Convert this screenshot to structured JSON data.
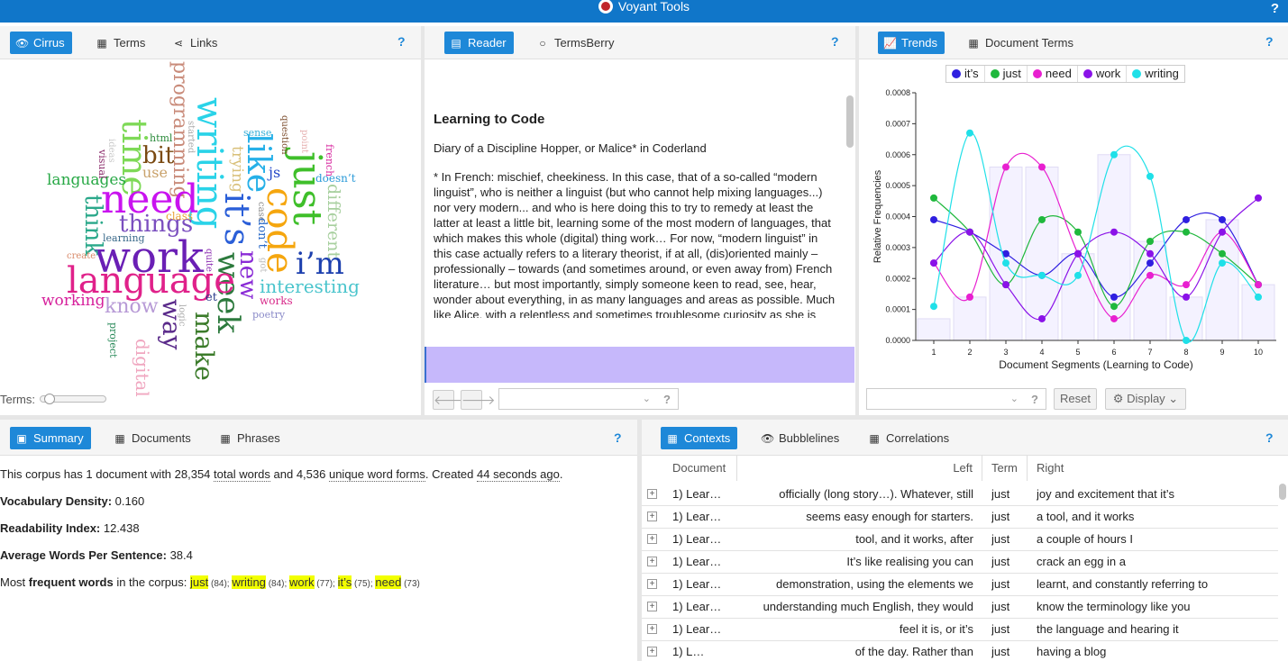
{
  "app": {
    "title": "Voyant Tools",
    "help": "?"
  },
  "panels": {
    "cirrus": {
      "tabs": [
        "Cirrus",
        "Terms",
        "Links"
      ],
      "help": "?",
      "terms_label": "Terms:",
      "cloud": [
        {
          "w": "programming",
          "c": "#c98b7a"
        },
        {
          "w": "writing",
          "c": "#2ad3e8"
        },
        {
          "w": "like",
          "c": "#26b0e8"
        },
        {
          "w": "just",
          "c": "#3fbf2a"
        },
        {
          "w": "code",
          "c": "#f5a60e"
        },
        {
          "w": "time",
          "c": "#7ed957"
        },
        {
          "w": "need",
          "c": "#c913ef"
        },
        {
          "w": "it’s",
          "c": "#2b5fd8"
        },
        {
          "w": "week",
          "c": "#2c7a3d"
        },
        {
          "w": "work",
          "c": "#6a1fb5"
        },
        {
          "w": "language",
          "c": "#e0218a"
        },
        {
          "w": "i’m",
          "c": "#1c3fae"
        },
        {
          "w": "things",
          "c": "#7b4fbf"
        },
        {
          "w": "bit",
          "c": "#7a4a12"
        },
        {
          "w": "languages",
          "c": "#27a845"
        },
        {
          "w": "think",
          "c": "#2aa88a"
        },
        {
          "w": "new",
          "c": "#8a2bd6"
        },
        {
          "w": "way",
          "c": "#5a2a8a"
        },
        {
          "w": "make",
          "c": "#3b7b2a"
        },
        {
          "w": "interesting",
          "c": "#49c4cc"
        },
        {
          "w": "different",
          "c": "#a7cf9e"
        },
        {
          "w": "know",
          "c": "#b79ad6"
        },
        {
          "w": "working",
          "c": "#d61f9b"
        },
        {
          "w": "digital",
          "c": "#f0a7c0"
        },
        {
          "w": "use",
          "c": "#c9a26b"
        },
        {
          "w": "js",
          "c": "#2648c8"
        },
        {
          "w": "trying",
          "c": "#d9c07a"
        },
        {
          "w": "html",
          "c": "#2a8a3a"
        },
        {
          "w": "class",
          "c": "#e8a43a"
        },
        {
          "w": "learning",
          "c": "#3a6a8a"
        },
        {
          "w": "doesn’t",
          "c": "#2a9ad8"
        },
        {
          "w": "french",
          "c": "#d82aa0"
        },
        {
          "w": "question",
          "c": "#7a4a2a"
        },
        {
          "w": "point",
          "c": "#e6b0b0"
        },
        {
          "w": "sense",
          "c": "#3ab0d8"
        },
        {
          "w": "started",
          "c": "#aaaaaa"
        },
        {
          "w": "case",
          "c": "#888888"
        },
        {
          "w": "don’t",
          "c": "#2a6ac8"
        },
        {
          "w": "got",
          "c": "#bbbbbb"
        },
        {
          "w": "works",
          "c": "#d82a8a"
        },
        {
          "w": "poetry",
          "c": "#8a8ac8"
        },
        {
          "w": "et",
          "c": "#2a3a8a"
        },
        {
          "w": "quite",
          "c": "#8a2ab0"
        },
        {
          "w": "logic",
          "c": "#aaaaaa"
        },
        {
          "w": "create",
          "c": "#d88a6a"
        },
        {
          "w": "visual",
          "c": "#8a2a6a"
        },
        {
          "w": "ideas",
          "c": "#c8c8c8"
        },
        {
          "w": "project",
          "c": "#2a8a5a"
        }
      ]
    },
    "reader": {
      "tabs": [
        "Reader",
        "TermsBerry"
      ],
      "help": "?",
      "doc_title": "Learning to Code",
      "subtitle": "Diary of a Discipline Hopper, or Malice* in Coderland",
      "body": "* In French: mischief, cheekiness. In this case, that of a so-called “modern linguist”, who is neither a linguist (but who cannot help mixing languages...) nor very modern... and who is here doing this to try to remedy at least the latter at least a little bit, learning some of the most modern of languages, that which makes this whole (digital) thing work… For now, “modern linguist” in this case actually refers to a literary theorist, if at all, (dis)oriented mainly – professionally – towards (and sometimes around, or even away from) French literature… but most importantly, simply someone keen to read, see, hear, wonder about everything, in as many languages and areas as possible. Much like Alice, with a relentless and sometimes troublesome curiosity as she is trying to cross borders… You can find a short conversation about this project here. (NB. The formatting and structuring of",
      "nav_prev": "🡐",
      "nav_next": "🡒",
      "combo_help": "?"
    },
    "trends": {
      "tabs": [
        "Trends",
        "Document Terms"
      ],
      "help": "?",
      "reset_label": "Reset",
      "display_label": "Display",
      "combo_help": "?"
    },
    "summary": {
      "tabs": [
        "Summary",
        "Documents",
        "Phrases"
      ],
      "help": "?",
      "line1_a": "This corpus has 1 document with 28,354 ",
      "line1_b": "total words",
      "line1_c": " and 4,536 ",
      "line1_d": "unique word forms",
      "line1_e": ". Created ",
      "line1_f": "44 seconds ago",
      "line1_g": ".",
      "vocab_label": "Vocabulary Density:",
      "vocab_value": " 0.160",
      "read_label": "Readability Index:",
      "read_value": " 12.438",
      "avg_label": "Average Words Per Sentence:",
      "avg_value": " 38.4",
      "freq_a": "Most ",
      "freq_b": "frequent words",
      "freq_c": " in the corpus: ",
      "freq": [
        {
          "w": "just",
          "n": " (84); "
        },
        {
          "w": "writing",
          "n": " (84); "
        },
        {
          "w": "work",
          "n": " (77); "
        },
        {
          "w": "it’s",
          "n": " (75); "
        },
        {
          "w": "need",
          "n": " (73)"
        }
      ]
    },
    "contexts": {
      "tabs": [
        "Contexts",
        "Bubblelines",
        "Correlations"
      ],
      "help": "?",
      "columns": [
        "Document",
        "Left",
        "Term",
        "Right"
      ],
      "rows": [
        {
          "doc": "1) Lear…",
          "left": "officially (long story…). Whatever, still",
          "term": "just",
          "right": "joy and excitement that it’s"
        },
        {
          "doc": "1) Lear…",
          "left": "seems easy enough for starters.",
          "term": "just",
          "right": "a tool, and it works"
        },
        {
          "doc": "1) Lear…",
          "left": "tool, and it works, after",
          "term": "just",
          "right": "a couple of hours I"
        },
        {
          "doc": "1) Lear…",
          "left": "It’s like realising you can",
          "term": "just",
          "right": "crack an egg in a"
        },
        {
          "doc": "1) Lear…",
          "left": "demonstration, using the elements we",
          "term": "just",
          "right": "learnt, and constantly referring to"
        },
        {
          "doc": "1) Lear…",
          "left": "understanding much English, they would",
          "term": "just",
          "right": "know the terminology like you"
        },
        {
          "doc": "1) Lear…",
          "left": "feel it is, or it’s",
          "term": "just",
          "right": "the language and hearing it"
        },
        {
          "doc": "1) L…",
          "left": "of the day. Rather than",
          "term": "just",
          "right": "having a blog"
        }
      ]
    }
  },
  "chart_data": {
    "type": "line",
    "title": "",
    "xlabel": "Document Segments (Learning to Code)",
    "ylabel": "Relative Frequencies",
    "x": [
      1,
      2,
      3,
      4,
      5,
      6,
      7,
      8,
      9,
      10
    ],
    "ylim": [
      0,
      0.0008
    ],
    "yticks": [
      "0.0000",
      "0.0001",
      "0.0002",
      "0.0003",
      "0.0004",
      "0.0005",
      "0.0006",
      "0.0007",
      "0.0008"
    ],
    "legend_position": "top",
    "series": [
      {
        "name": "it’s",
        "color": "#2f1fe0",
        "values": [
          0.00039,
          0.00035,
          0.00028,
          0.00021,
          0.00028,
          0.00014,
          0.00025,
          0.00039,
          0.00039,
          0.00018
        ]
      },
      {
        "name": "just",
        "color": "#1fb83c",
        "values": [
          0.00046,
          0.00035,
          0.00018,
          0.00039,
          0.00035,
          0.00011,
          0.00032,
          0.00035,
          0.00028,
          0.00018
        ]
      },
      {
        "name": "need",
        "color": "#e81fd0",
        "values": [
          0.00025,
          0.00014,
          0.00056,
          0.00056,
          0.00028,
          7e-05,
          0.00021,
          0.00018,
          0.00035,
          0.00018
        ]
      },
      {
        "name": "work",
        "color": "#8a12e8",
        "values": [
          0.00025,
          0.00035,
          0.00018,
          7e-05,
          0.00028,
          0.00035,
          0.00028,
          0.00014,
          0.00035,
          0.00046
        ]
      },
      {
        "name": "writing",
        "color": "#1fe0e8",
        "values": [
          0.00011,
          0.00067,
          0.00025,
          0.00021,
          0.00021,
          0.0006,
          0.00053,
          0.0,
          0.00025,
          0.00014
        ]
      }
    ],
    "bars": [
      7e-05,
      0.00014,
      0.00056,
      0.00056,
      0.00028,
      0.0006,
      0.00032,
      0.00014,
      0.00039,
      0.00018
    ]
  }
}
